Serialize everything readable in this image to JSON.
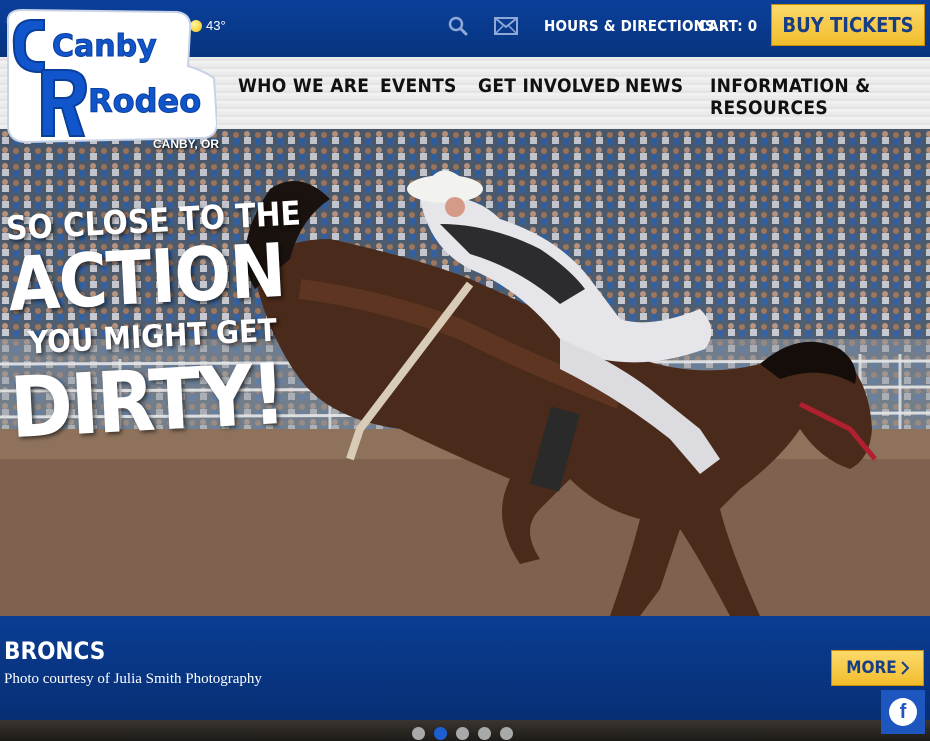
{
  "weather": {
    "temperature": "43°",
    "icon": "sun-icon"
  },
  "header": {
    "hours_label": "HOURS & DIRECTIONS",
    "cart_label": "CART: 0",
    "buy_label": "BUY TICKETS"
  },
  "logo": {
    "line1": "Canby",
    "line2": "Rodeo",
    "location": "CANBY, OR"
  },
  "nav": {
    "items": [
      {
        "label": "WHO WE ARE"
      },
      {
        "label": "EVENTS"
      },
      {
        "label": "GET INVOLVED"
      },
      {
        "label": "NEWS"
      },
      {
        "label": "INFORMATION & RESOURCES"
      }
    ]
  },
  "hero": {
    "line1": "SO CLOSE TO THE",
    "line2": "ACTION",
    "line3": "YOU MIGHT GET",
    "line4": "DIRTY!"
  },
  "slide": {
    "title": "BRONCS",
    "credit": "Photo courtesy of Julia Smith Photography",
    "more_label": "MORE"
  },
  "slider": {
    "count": 5,
    "active_index": 1
  },
  "colors": {
    "brand_blue": "#0a3f9a",
    "accent_gold": "#f2bd2c"
  }
}
